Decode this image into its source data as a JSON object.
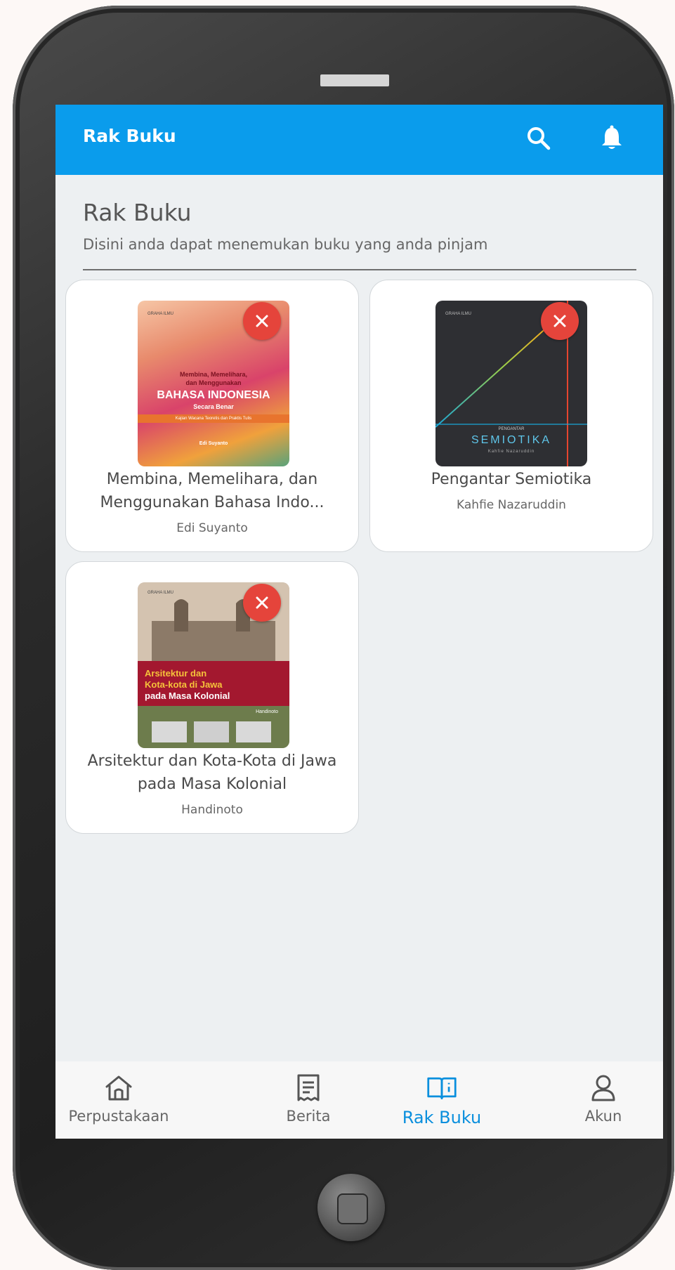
{
  "appbar": {
    "title": "Rak Buku"
  },
  "page": {
    "title": "Rak Buku",
    "subtitle": "Disini anda dapat menemukan buku yang anda pinjam"
  },
  "books": [
    {
      "title": "Membina, Memelihara, dan Menggunakan Bahasa Indo...",
      "author": "Edi Suyanto",
      "cover": {
        "publisher": "GRAHA ILMU",
        "line1": "Membina, Memelihara,",
        "line2": "dan Menggunakan",
        "line3": "BAHASA INDONESIA",
        "line4": "Secara Benar",
        "line5": "Kajian Wacana Teoretis dan Praktis Tulis",
        "author": "Edi Suyanto"
      }
    },
    {
      "title": "Pengantar Semiotika",
      "author": "Kahfie Nazaruddin",
      "cover": {
        "publisher": "GRAHA ILMU",
        "line1": "PENGANTAR",
        "line2": "SEMIOTIKA",
        "author": "Kahfie Nazaruddin"
      }
    },
    {
      "title": "Arsitektur dan Kota-Kota di Jawa pada Masa Kolonial",
      "author": "Handinoto",
      "cover": {
        "publisher": "GRAHA ILMU",
        "line1": "Arsitektur dan",
        "line2": "Kota-kota di Jawa",
        "line3": "pada Masa Kolonial",
        "author": "Handinoto"
      }
    }
  ],
  "nav": [
    {
      "label": "Perpustakaan",
      "icon": "home-icon"
    },
    {
      "label": "Berita",
      "icon": "news-icon"
    },
    {
      "label": "Rak Buku",
      "icon": "book-open-icon",
      "active": true
    },
    {
      "label": "Akun",
      "icon": "user-icon"
    }
  ],
  "colors": {
    "primary": "#0a9cec",
    "active_nav": "#0a8fdd",
    "remove": "#e5443b"
  }
}
